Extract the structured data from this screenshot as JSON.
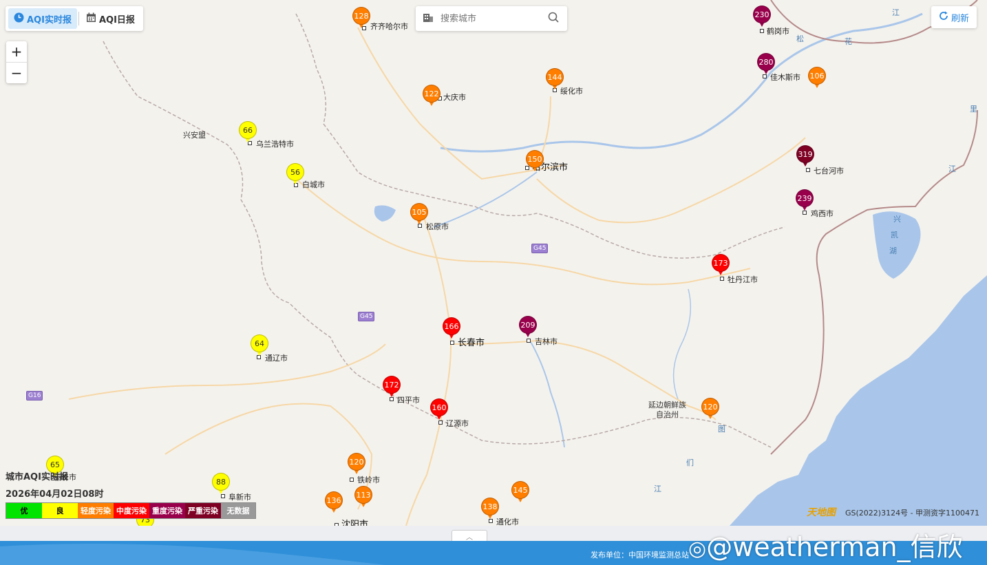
{
  "tabs": {
    "realtime": "AQI实时报",
    "daily": "AQI日报"
  },
  "zoom": {
    "in": "+",
    "out": "−"
  },
  "search": {
    "placeholder": "搜索城市"
  },
  "refresh": {
    "label": "刷新"
  },
  "legend": {
    "title": "城市AQI实时报",
    "time": "2026年04月02日08时",
    "levels": [
      {
        "label": "优",
        "color": "#00e400",
        "text_color": "#000"
      },
      {
        "label": "良",
        "color": "#ffff00",
        "text_color": "#000"
      },
      {
        "label": "轻度污染",
        "color": "#ff7e00",
        "text_color": "#fff"
      },
      {
        "label": "中度污染",
        "color": "#ff0000",
        "text_color": "#fff"
      },
      {
        "label": "重度污染",
        "color": "#99004c",
        "text_color": "#fff"
      },
      {
        "label": "严重污染",
        "color": "#7e0023",
        "text_color": "#fff"
      },
      {
        "label": "无数据",
        "color": "#999999",
        "text_color": "#fff"
      }
    ]
  },
  "cities": [
    {
      "name": "齐齐哈尔市",
      "aqi": "128",
      "level": "orange"
    },
    {
      "name": "鹤岗市",
      "aqi": "230",
      "level": "purple"
    },
    {
      "name": "佳木斯市",
      "aqi": "280",
      "level": "purple"
    },
    {
      "name": "",
      "aqi": "106",
      "level": "orange"
    },
    {
      "name": "绥化市",
      "aqi": "144",
      "level": "orange"
    },
    {
      "name": "大庆市",
      "aqi": "122",
      "level": "orange"
    },
    {
      "name": "乌兰浩特市",
      "aqi": "66",
      "level": "yellow"
    },
    {
      "name": "白城市",
      "aqi": "56",
      "level": "yellow"
    },
    {
      "name": "哈尔滨市",
      "aqi": "150",
      "level": "orange"
    },
    {
      "name": "七台河市",
      "aqi": "319",
      "level": "maroon"
    },
    {
      "name": "鸡西市",
      "aqi": "239",
      "level": "purple"
    },
    {
      "name": "松原市",
      "aqi": "105",
      "level": "orange"
    },
    {
      "name": "牡丹江市",
      "aqi": "173",
      "level": "red"
    },
    {
      "name": "长春市",
      "aqi": "166",
      "level": "red"
    },
    {
      "name": "吉林市",
      "aqi": "209",
      "level": "purple"
    },
    {
      "name": "通辽市",
      "aqi": "64",
      "level": "yellow"
    },
    {
      "name": "四平市",
      "aqi": "172",
      "level": "red"
    },
    {
      "name": "辽源市",
      "aqi": "160",
      "level": "red"
    },
    {
      "name": "",
      "aqi": "120",
      "level": "orange"
    },
    {
      "name": "铁岭市",
      "aqi": "120",
      "level": "orange"
    },
    {
      "name": "赤峰市",
      "aqi": "65",
      "level": "yellow"
    },
    {
      "name": "阜新市",
      "aqi": "88",
      "level": "yellow"
    },
    {
      "name": "",
      "aqi": "113",
      "level": "orange"
    },
    {
      "name": "沈阳市",
      "aqi": "136",
      "level": "orange"
    },
    {
      "name": "通化市",
      "aqi": "138",
      "level": "orange"
    },
    {
      "name": "",
      "aqi": "145",
      "level": "orange"
    },
    {
      "name": "",
      "aqi": "73",
      "level": "yellow"
    }
  ],
  "place_labels": {
    "xinganmeng": "兴安盟",
    "yanbian": "延边朝鲜族\n自治州"
  },
  "water_labels": [
    "江",
    "松",
    "花",
    "里",
    "江",
    "兴",
    "凯",
    "湖",
    "图",
    "们",
    "江"
  ],
  "roads": [
    "G45",
    "G45",
    "G16"
  ],
  "copyright": "GS(2022)3124号 - 甲测资字1100471",
  "tdt_logo": "天地图",
  "footer": {
    "publisher": "发布单位：中国环境监测总站"
  },
  "watermark": "@weatherman_信欣",
  "colors": {
    "yellow": "#ffff00",
    "orange": "#ff7e00",
    "red": "#ff0000",
    "purple": "#99004c",
    "maroon": "#7e0023",
    "accent": "#2a87dd"
  }
}
